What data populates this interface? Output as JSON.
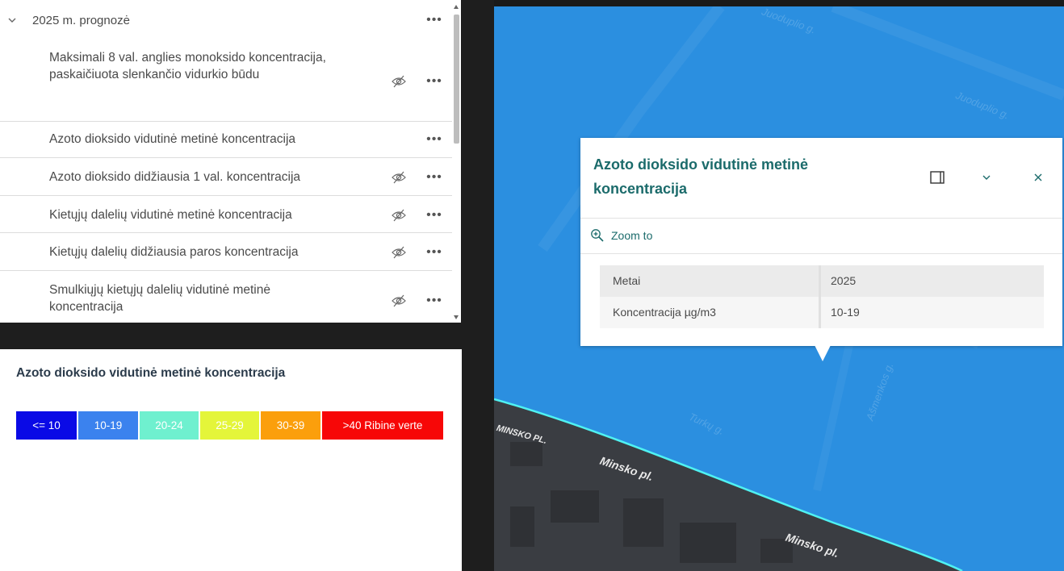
{
  "layer_list": {
    "group_title": "2025 m. prognozė",
    "items": [
      {
        "label": "Maksimali 8 val. anglies monoksido koncentracija, paskaičiuota slenkančio vidurkio būdu",
        "visible": false
      },
      {
        "label": "Azoto dioksido vidutinė metinė koncentracija",
        "visible": true
      },
      {
        "label": "Azoto dioksido didžiausia 1 val. koncentracija",
        "visible": false
      },
      {
        "label": "Kietųjų dalelių vidutinė metinė koncentracija",
        "visible": false
      },
      {
        "label": "Kietųjų dalelių didžiausia paros koncentracija",
        "visible": false
      },
      {
        "label": "Smulkiųjų kietųjų dalelių vidutinė metinė koncentracija",
        "visible": false
      }
    ]
  },
  "legend": {
    "title": "Azoto dioksido vidutinė metinė koncentracija",
    "classes": [
      {
        "label": "<= 10",
        "color": "#0a0ae6",
        "text_color": "#ffffff"
      },
      {
        "label": "10-19",
        "color": "#3b82ee",
        "text_color": "#ffffff"
      },
      {
        "label": "20-24",
        "color": "#6ff0cf",
        "text_color": "#ffffff"
      },
      {
        "label": "25-29",
        "color": "#e4f53a",
        "text_color": "#ffffff"
      },
      {
        "label": "30-39",
        "color": "#fb9f0c",
        "text_color": "#ffffff"
      },
      {
        "label": ">40 Ribine verte",
        "color": "#f70707",
        "text_color": "#ffffff"
      }
    ]
  },
  "map": {
    "street_labels": [
      "Juoduplio g.",
      "Juoduplio g.",
      "Turkų g.",
      "Ašmenkos g.",
      "MINSKO PL.",
      "Minsko pl.",
      "Minsko pl."
    ],
    "fill_color": "#2b8fe0",
    "boundary_color": "#4ff2f2"
  },
  "popup": {
    "title": "Azoto dioksido vidutinė metinė koncentracija",
    "zoom_label": "Zoom to",
    "attributes": [
      {
        "key": "Metai",
        "value": "2025"
      },
      {
        "key": "Koncentracija µg/m3",
        "value": "10-19"
      }
    ],
    "accent_color": "#1b6b6b"
  }
}
